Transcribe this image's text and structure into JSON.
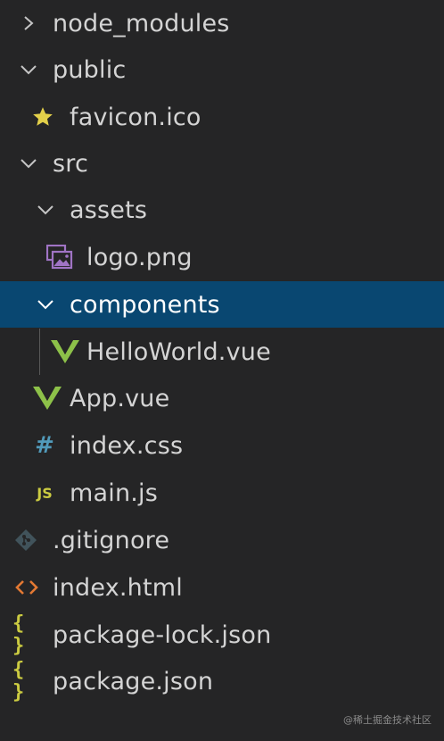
{
  "tree": {
    "items": [
      {
        "label": "node_modules",
        "kind": "folder",
        "state": "collapsed",
        "icon": "chevron-right-icon"
      },
      {
        "label": "public",
        "kind": "folder",
        "state": "expanded",
        "icon": "chevron-down-icon"
      },
      {
        "label": "favicon.ico",
        "kind": "file",
        "icon": "star-icon",
        "icon_color": "#e3d04a"
      },
      {
        "label": "src",
        "kind": "folder",
        "state": "expanded",
        "icon": "chevron-down-icon"
      },
      {
        "label": "assets",
        "kind": "folder",
        "state": "expanded",
        "icon": "chevron-down-icon"
      },
      {
        "label": "logo.png",
        "kind": "file",
        "icon": "image-icon",
        "icon_color": "#a074c4"
      },
      {
        "label": "components",
        "kind": "folder",
        "state": "expanded",
        "selected": true,
        "icon": "chevron-down-icon"
      },
      {
        "label": "HelloWorld.vue",
        "kind": "file",
        "icon": "vue-icon",
        "icon_color": "#8dc149"
      },
      {
        "label": "App.vue",
        "kind": "file",
        "icon": "vue-icon",
        "icon_color": "#8dc149"
      },
      {
        "label": "index.css",
        "kind": "file",
        "icon": "hash-icon",
        "icon_color": "#519aba",
        "icon_glyph": "#"
      },
      {
        "label": "main.js",
        "kind": "file",
        "icon": "js-icon",
        "icon_color": "#cbcb41",
        "icon_glyph": "JS"
      },
      {
        "label": ".gitignore",
        "kind": "file",
        "icon": "git-icon",
        "icon_color": "#41535b"
      },
      {
        "label": "index.html",
        "kind": "file",
        "icon": "code-brackets-icon",
        "icon_color": "#e37933",
        "icon_glyph": "<>"
      },
      {
        "label": "package-lock.json",
        "kind": "file",
        "icon": "curly-braces-icon",
        "icon_color": "#cbcb41",
        "icon_glyph": "{ }"
      },
      {
        "label": "package.json",
        "kind": "file",
        "icon": "curly-braces-icon",
        "icon_color": "#cbcb41",
        "icon_glyph": "{ }"
      }
    ]
  },
  "colors": {
    "background": "#252526",
    "selection": "#094771",
    "text": "#d4d4d4",
    "chevron": "#c5c5c5"
  },
  "watermark": "@稀土掘金技术社区"
}
